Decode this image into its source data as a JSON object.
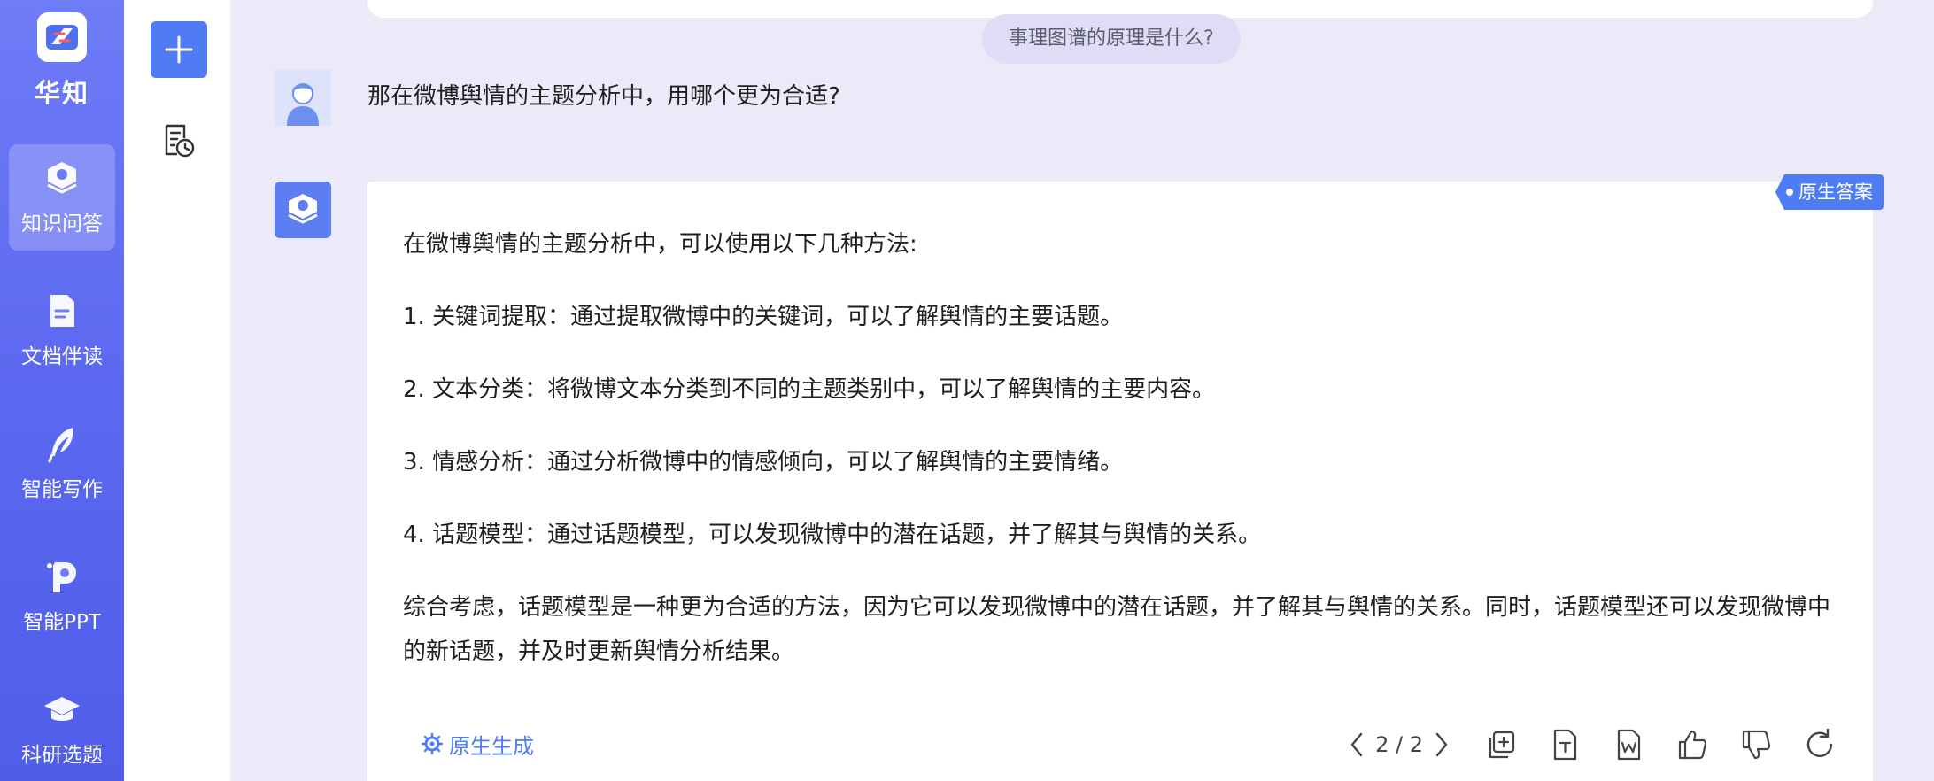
{
  "app": {
    "name": "华知",
    "brand_color": "#5b68f0",
    "accent_color": "#4e7cf4"
  },
  "nav": {
    "items": [
      {
        "label": "知识问答",
        "icon": "qa-icon",
        "active": true
      },
      {
        "label": "文档伴读",
        "icon": "document-icon",
        "active": false
      },
      {
        "label": "智能写作",
        "icon": "quill-icon",
        "active": false
      },
      {
        "label": "智能PPT",
        "icon": "ppt-icon",
        "active": false
      },
      {
        "label": "科研选题",
        "icon": "graduation-cap-icon",
        "active": false
      }
    ]
  },
  "sidebar": {
    "new_chat_icon": "plus-icon",
    "history_icon": "history-icon"
  },
  "chat": {
    "suggestion": "事理图谱的原理是什么?",
    "user_message": "那在微博舆情的主题分析中，用哪个更为合适?",
    "answer": {
      "badge": "原生答案",
      "paragraphs": [
        "在微博舆情的主题分析中，可以使用以下几种方法:",
        "1. 关键词提取：通过提取微博中的关键词，可以了解舆情的主要话题。",
        "2. 文本分类：将微博文本分类到不同的主题类别中，可以了解舆情的主要内容。",
        "3. 情感分析：通过分析微博中的情感倾向，可以了解舆情的主要情绪。",
        "4. 话题模型：通过话题模型，可以发现微博中的潜在话题，并了解其与舆情的关系。",
        "综合考虑，话题模型是一种更为合适的方法，因为它可以发现微博中的潜在话题，并了解其与舆情的关系。同时，话题模型还可以发现微博中的新话题，并及时更新舆情分析结果。"
      ],
      "source_label": "原生生成",
      "pager": "2 / 2"
    }
  }
}
